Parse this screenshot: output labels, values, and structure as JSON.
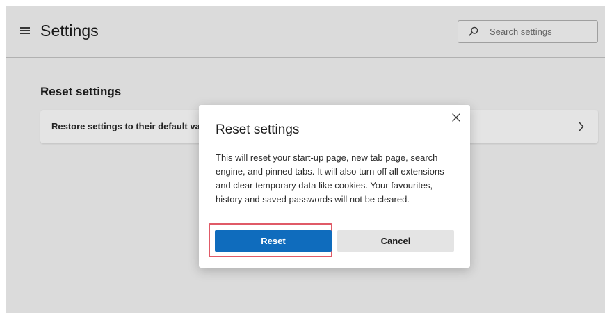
{
  "header": {
    "title": "Settings",
    "menu_icon": "hamburger-menu-icon",
    "search": {
      "placeholder": "Search settings",
      "icon": "search-icon"
    }
  },
  "main": {
    "section_title": "Reset settings",
    "card": {
      "label": "Restore settings to their default values",
      "icon": "chevron-right-icon"
    }
  },
  "dialog": {
    "title": "Reset settings",
    "body": "This will reset your start-up page, new tab page, search engine, and pinned tabs. It will also turn off all extensions and clear temporary data like cookies. Your favourites, history and saved passwords will not be cleared.",
    "reset_label": "Reset",
    "cancel_label": "Cancel",
    "close_icon": "close-icon"
  },
  "colors": {
    "accent": "#0f6cbd",
    "highlight_border": "#e05a67",
    "background": "#e9e9e9"
  }
}
